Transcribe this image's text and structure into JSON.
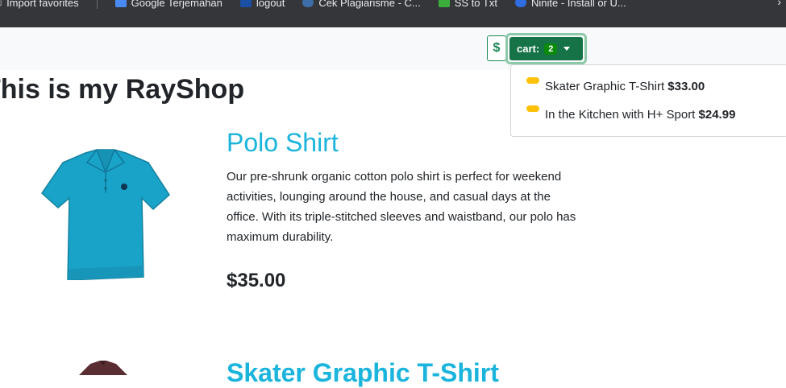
{
  "bookmarks": [
    {
      "label": "Import favorites",
      "icon": "import-icon"
    },
    {
      "label": "Google Terjemahan",
      "icon": "translate-icon"
    },
    {
      "label": "logout",
      "icon": "logout-icon"
    },
    {
      "label": "Cek Plagiarisme - C...",
      "icon": "plagiarism-icon"
    },
    {
      "label": "SS to Txt",
      "icon": "ss-to-txt-icon"
    },
    {
      "label": "Ninite - Install or U...",
      "icon": "ninite-icon"
    }
  ],
  "navbar": {
    "currency_symbol": "$",
    "cart_label": "cart:",
    "cart_count": "2"
  },
  "cart_items": [
    {
      "name": "Skater Graphic T-Shirt",
      "price": "$33.00"
    },
    {
      "name": "In the Kitchen with H+ Sport",
      "price": "$24.99"
    }
  ],
  "page": {
    "heading": "This is my RayShop"
  },
  "products": [
    {
      "title": "Polo Shirt",
      "description": "Our pre-shrunk organic cotton polo shirt is perfect for weekend activities, lounging around the house, and casual days at the office. With its triple-stitched sleeves and waistband, our polo has maximum durability.",
      "price": "$35.00",
      "image": "polo-shirt-image",
      "color": "#1ba3c6"
    },
    {
      "title": "Skater Graphic T-Shirt",
      "image": "skater-tshirt-image"
    }
  ],
  "colors": {
    "success": "#198754",
    "accent": "#1ab4dc",
    "badge": "#ffc107"
  }
}
